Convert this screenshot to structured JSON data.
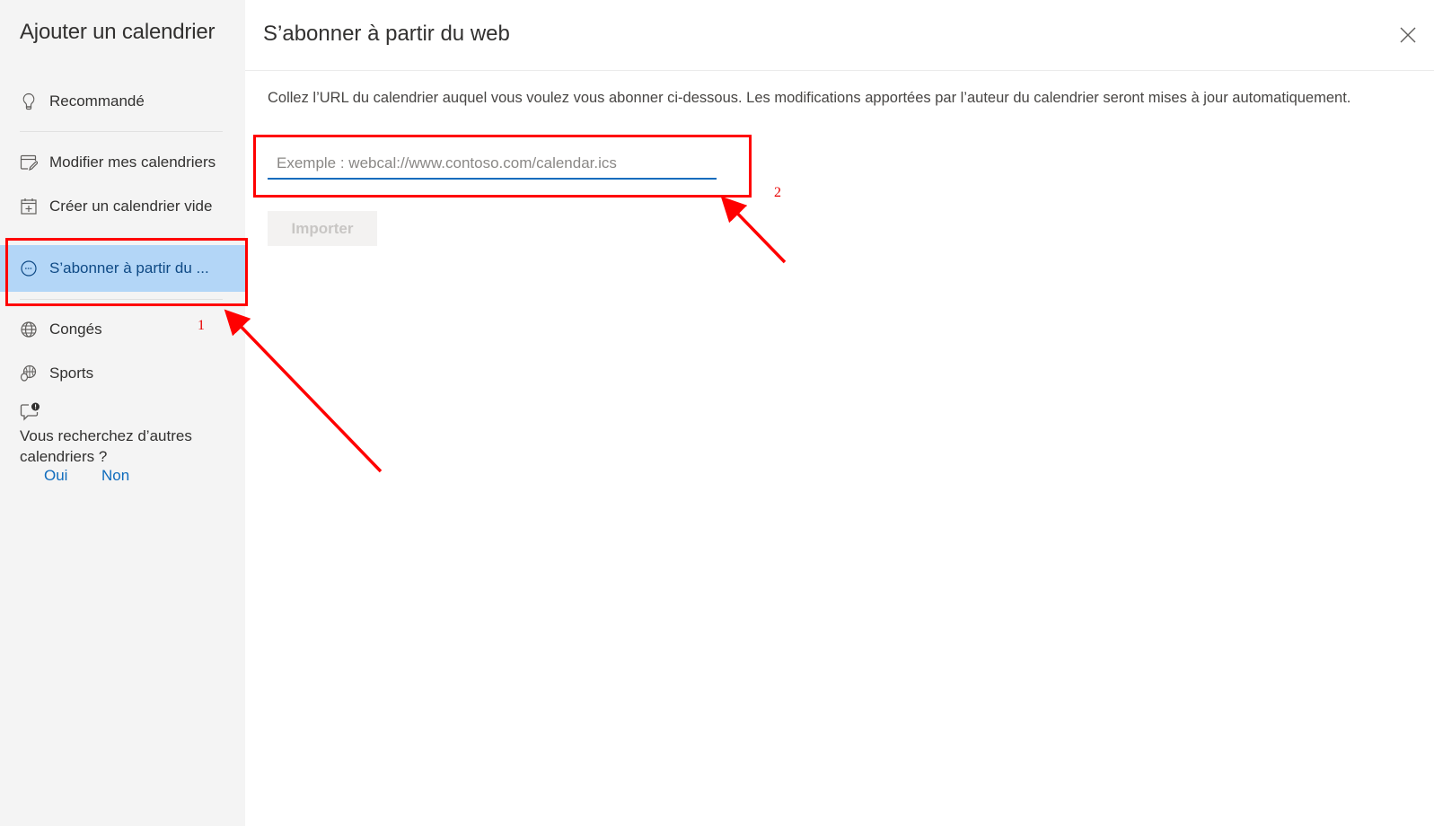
{
  "sidebar": {
    "title": "Ajouter un calendrier",
    "items": [
      {
        "label": "Recommandé",
        "icon": "lightbulb-icon"
      },
      {
        "label": "Modifier mes calendriers",
        "icon": "calendar-edit-icon"
      },
      {
        "label": "Créer un calendrier vide",
        "icon": "calendar-add-icon"
      },
      {
        "label": "S’abonner à partir du ...",
        "icon": "subscribe-web-icon",
        "selected": true
      },
      {
        "label": "Congés",
        "icon": "globe-icon"
      },
      {
        "label": "Sports",
        "icon": "sports-ball-icon"
      }
    ],
    "feedback": {
      "icon": "feedback-icon",
      "question": "Vous recherchez d’autres calendriers ?",
      "yes": "Oui",
      "no": "Non"
    }
  },
  "main": {
    "title": "S’abonner à partir du web",
    "close_icon": "close-icon",
    "description": "Collez l’URL du calendrier auquel vous voulez vous abonner ci-dessous. Les modifications apportées par l’auteur du calendrier seront mises à jour automatiquement.",
    "url_input": {
      "value": "",
      "placeholder": "Exemple : webcal://www.contoso.com/calendar.ics"
    },
    "import_button": "Importer"
  },
  "annotations": {
    "step1": "1",
    "step2": "2",
    "color": "#ff0000"
  }
}
